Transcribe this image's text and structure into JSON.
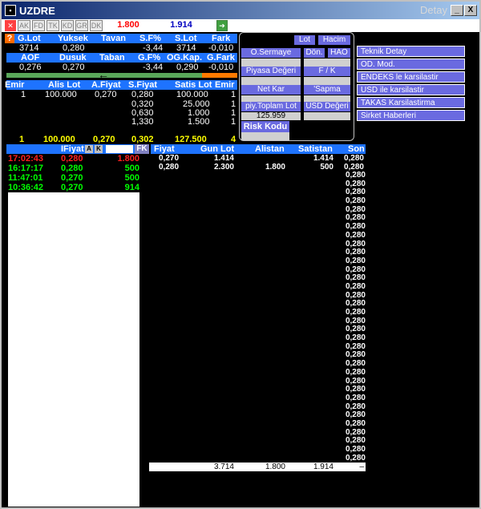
{
  "window": {
    "title": "UZDRE",
    "right_title": "Detay",
    "min": "_",
    "max": "□",
    "close": "X"
  },
  "toolbar": {
    "icons": [
      "AK",
      "FD",
      "TK",
      "KD",
      "GR",
      "DK"
    ],
    "value_red": "1.800",
    "value_blue": "1.914"
  },
  "summary1": {
    "headers": [
      "G.Lot",
      "Yuksek",
      "Tavan",
      "S.F%",
      "S.Lot",
      "Fark"
    ],
    "values": [
      "3714",
      "0,280",
      "",
      "-3,44",
      "3714",
      "-0,010"
    ]
  },
  "summary2": {
    "headers": [
      "AOF",
      "Dusuk",
      "Taban",
      "G.F%",
      "OG.Kap.",
      "G.Fark"
    ],
    "values": [
      "0,276",
      "0,270",
      "",
      "-3,44",
      "0,290",
      "-0,010"
    ]
  },
  "order_book": {
    "headers": [
      "Emir",
      "Alis Lot",
      "A.Fiyat",
      "S.Fiyat",
      "Satis Lot",
      "Emir"
    ],
    "rows": [
      [
        "1",
        "100.000",
        "0,270",
        "0,280",
        "100.000",
        "1"
      ],
      [
        "",
        "",
        "",
        "0,320",
        "25.000",
        "1"
      ],
      [
        "",
        "",
        "",
        "0,630",
        "1.000",
        "1"
      ],
      [
        "",
        "",
        "",
        "1,330",
        "1.500",
        "1"
      ]
    ],
    "totals": [
      "1",
      "100.000",
      "0,270",
      "0,302",
      "127.500",
      "4"
    ]
  },
  "panel": {
    "lot": "Lot",
    "hacim": "Hacim",
    "o_sermaye": "O.Sermaye",
    "don": "Dön.",
    "hao": "HAO",
    "piyasa_degeri": "Piyasa Değeri",
    "f_k": "F / K",
    "net_kar": "Net Kar",
    "sapma": "'Sapma",
    "piy_toplam_lot": "piy.Toplam Lot",
    "piy_toplam_lot_value": "125.959",
    "usd_degeri": "USD Değeri",
    "risk_kodu": "Risk Kodu"
  },
  "side_buttons": [
    "Teknik Detay",
    "OD. Mod.",
    "ENDEKS le karsilastir",
    "USD ile karsilastir",
    "TAKAS Karsilastirma",
    "Sirket Haberleri"
  ],
  "trades": {
    "header": "IFiyat",
    "a_btn": "A",
    "k_btn": "K",
    "fk_btn": "FK",
    "rows": [
      {
        "time": "17:02:43",
        "price": "0,280",
        "lot": "1.800",
        "color": "#ff2020"
      },
      {
        "time": "16:17:17",
        "price": "0,280",
        "lot": "500",
        "color": "#00ff00"
      },
      {
        "time": "11:47:01",
        "price": "0,270",
        "lot": "500",
        "color": "#00ff00"
      },
      {
        "time": "10:36:42",
        "price": "0,270",
        "lot": "914",
        "color": "#00ff00"
      }
    ]
  },
  "depth": {
    "headers": [
      "Fiyat",
      "Gun Lot",
      "Alistan",
      "Satistan",
      "Son"
    ],
    "rows": [
      [
        "0,270",
        "1.414",
        "",
        "1.414",
        "0,280"
      ],
      [
        "0,280",
        "2.300",
        "1.800",
        "500",
        "0,280"
      ]
    ],
    "son_value": "0,280",
    "totals": [
      "",
      "3.714",
      "1.800",
      "1.914",
      "–"
    ]
  }
}
